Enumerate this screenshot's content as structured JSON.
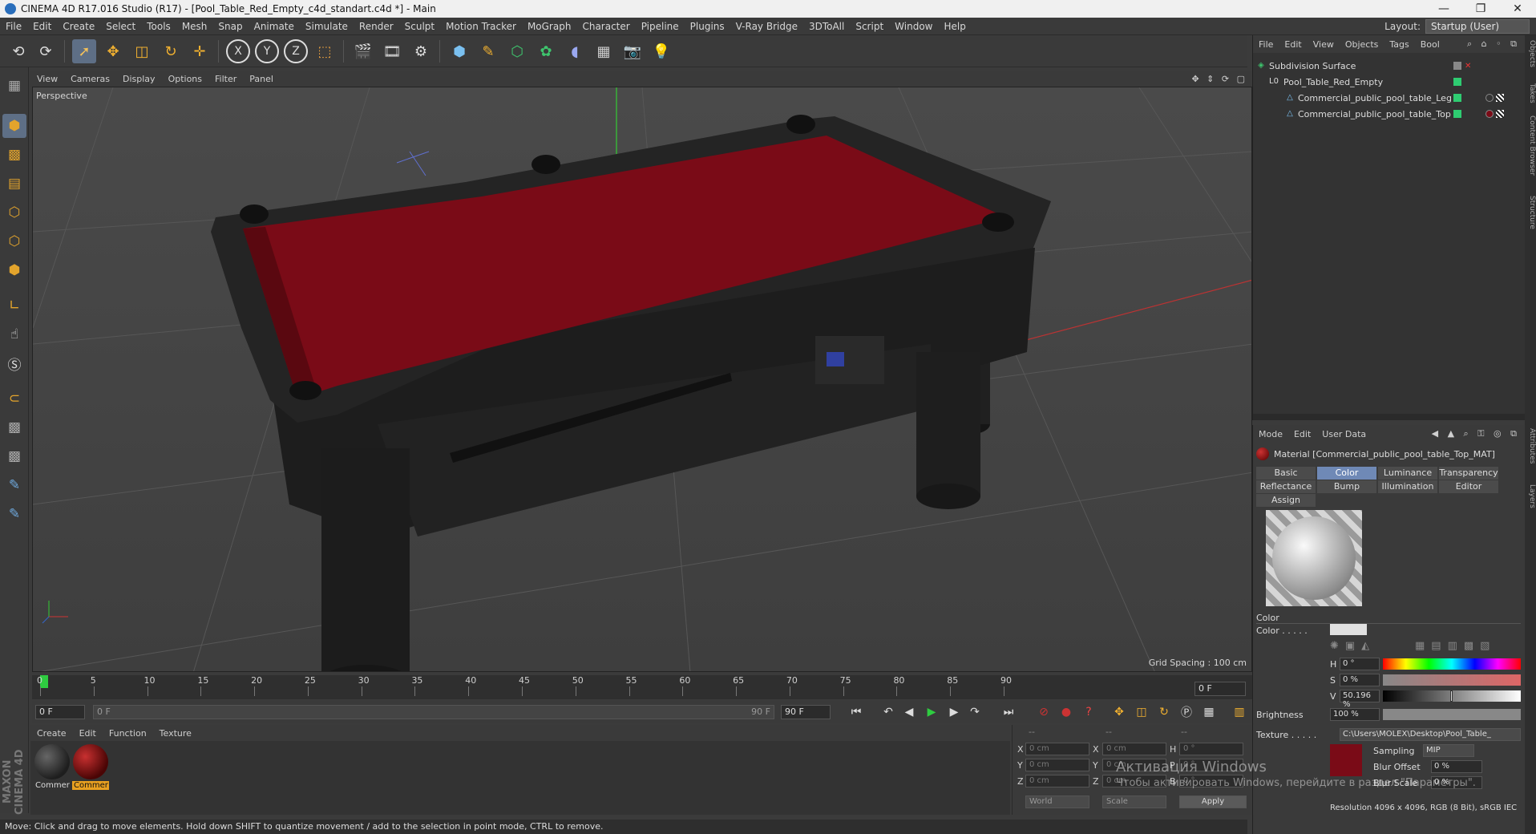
{
  "titlebar": {
    "title": "CINEMA 4D R17.016 Studio (R17) - [Pool_Table_Red_Empty_c4d_standart.c4d *] - Main",
    "min": "—",
    "max": "❐",
    "close": "✕"
  },
  "menu": [
    "File",
    "Edit",
    "Create",
    "Select",
    "Tools",
    "Mesh",
    "Snap",
    "Animate",
    "Simulate",
    "Render",
    "Sculpt",
    "Motion Tracker",
    "MoGraph",
    "Character",
    "Pipeline",
    "Plugins",
    "V-Ray Bridge",
    "3DToAll",
    "Script",
    "Window",
    "Help"
  ],
  "layout": {
    "label": "Layout:",
    "value": "Startup (User)"
  },
  "toolbar": {
    "undo": "⟲",
    "redo": "⟳",
    "x": "X",
    "y": "Y",
    "z": "Z"
  },
  "viewport": {
    "menu": [
      "View",
      "Cameras",
      "Display",
      "Options",
      "Filter",
      "Panel"
    ],
    "nav_icons": "✥ ⇕ ⟳ ▢",
    "label": "Perspective",
    "grid_spacing": "Grid Spacing : 100 cm"
  },
  "timeline": {
    "ticks": [
      "0",
      "5",
      "10",
      "15",
      "20",
      "25",
      "30",
      "35",
      "40",
      "45",
      "50",
      "55",
      "60",
      "65",
      "70",
      "75",
      "80",
      "85",
      "90"
    ],
    "current_frame": "0 F",
    "start": "0 F",
    "range_start": "0 F",
    "range_end": "90 F",
    "end": "90 F"
  },
  "material_manager": {
    "menu": [
      "Create",
      "Edit",
      "Function",
      "Texture"
    ],
    "materials": [
      {
        "name": "Commer",
        "color": "#333333",
        "selected": false
      },
      {
        "name": "Commer",
        "color": "#8b1010",
        "selected": true
      }
    ]
  },
  "coordinates": {
    "header": [
      "--",
      "--",
      "--"
    ],
    "rows": [
      {
        "a": "X",
        "av": "0 cm",
        "b": "X",
        "bv": "0 cm",
        "c": "H",
        "cv": "0 °"
      },
      {
        "a": "Y",
        "av": "0 cm",
        "b": "Y",
        "bv": "0 cm",
        "c": "P",
        "cv": "0 °"
      },
      {
        "a": "Z",
        "av": "0 cm",
        "b": "Z",
        "bv": "0 cm",
        "c": "B",
        "cv": "0 °"
      }
    ],
    "world": "World",
    "scale": "Scale",
    "apply": "Apply"
  },
  "status": "Move: Click and drag to move elements. Hold down SHIFT to quantize movement / add to the selection in point mode, CTRL to remove.",
  "object_manager": {
    "menu": [
      "File",
      "Edit",
      "View",
      "Objects",
      "Tags",
      "Bool"
    ],
    "objects": [
      {
        "name": "Subdivision Surface",
        "icon": "◈",
        "indent": 0
      },
      {
        "name": "Pool_Table_Red_Empty",
        "icon": "L0",
        "indent": 1
      },
      {
        "name": "Commercial_public_pool_table_Leg",
        "icon": "△",
        "indent": 2
      },
      {
        "name": "Commercial_public_pool_table_Top",
        "icon": "△",
        "indent": 2
      }
    ]
  },
  "attributes": {
    "menu": [
      "Mode",
      "Edit",
      "User Data"
    ],
    "material_title": "Material [Commercial_public_pool_table_Top_MAT]",
    "tabs": [
      "Basic",
      "Color",
      "Luminance",
      "Transparency",
      "Reflectance",
      "Bump",
      "Illumination",
      "Editor",
      "Assign"
    ],
    "active_tab": "Color",
    "section": "Color",
    "color_label": "Color . . . . .",
    "h_label": "H",
    "h_value": "0 °",
    "s_label": "S",
    "s_value": "0 %",
    "v_label": "V",
    "v_value": "50.196 %",
    "v_fraction": 0.502,
    "brightness_label": "Brightness",
    "brightness_value": "100 %",
    "brightness_fraction": 1.0,
    "texture_label": "Texture . . . . .",
    "texture_path": "C:\\Users\\MOLEX\\Desktop\\Pool_Table_",
    "sampling_label": "Sampling",
    "sampling_value": "MIP",
    "blur_offset_label": "Blur Offset",
    "blur_offset_value": "0 %",
    "blur_scale_label": "Blur Scale",
    "blur_scale_value": "0 %",
    "resolution": "Resolution 4096 x 4096, RGB (8 Bit), sRGB IEC"
  },
  "side_tabs": [
    "Objects",
    "Takes",
    "Content Browser",
    "Structure",
    "Attributes",
    "Layers"
  ],
  "watermark": {
    "line1": "Активация Windows",
    "line2": "Чтобы активировать Windows, перейдите в раздел \"Параметры\"."
  },
  "colors": {
    "accent": "#6f89b6",
    "playhead": "#2ecc40",
    "felt": "#7a0b17",
    "object_tag": "#2ecc71"
  }
}
